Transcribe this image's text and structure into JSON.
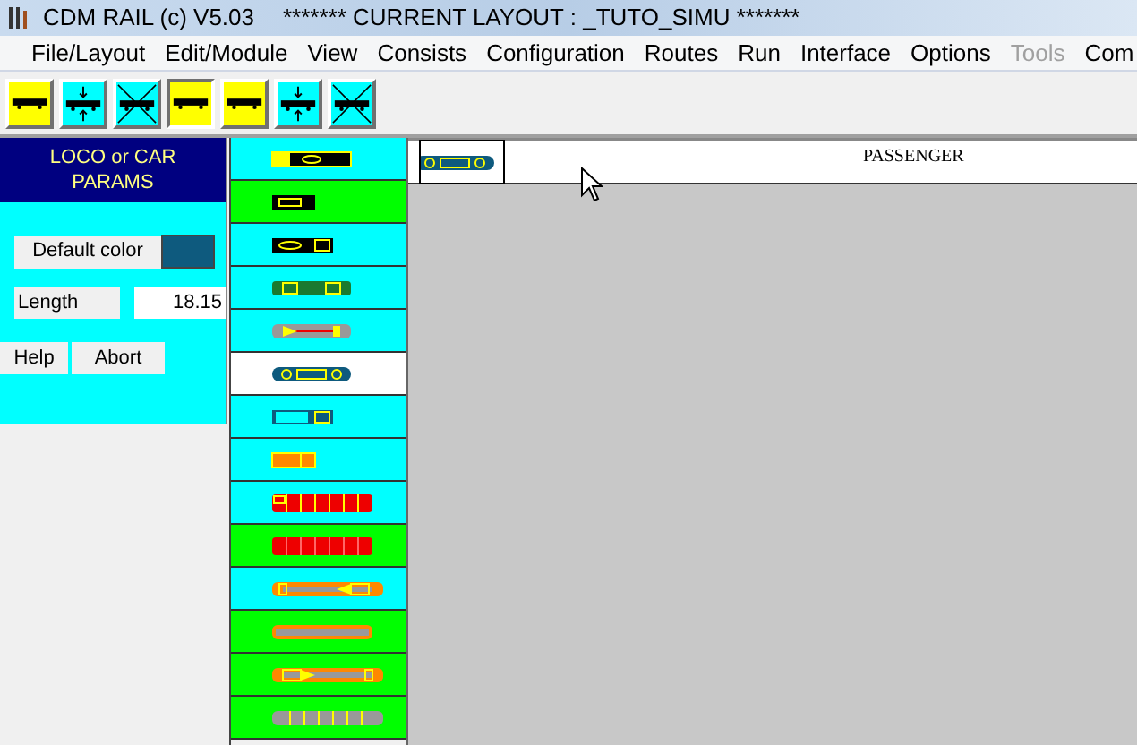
{
  "window": {
    "title": "CDM RAIL (c) V5.03",
    "layout_title": "******* CURRENT LAYOUT : _TUTO_SIMU *******"
  },
  "menu": [
    {
      "label": "File/Layout",
      "disabled": false
    },
    {
      "label": "Edit/Module",
      "disabled": false
    },
    {
      "label": "View",
      "disabled": false
    },
    {
      "label": "Consists",
      "disabled": false
    },
    {
      "label": "Configuration",
      "disabled": false
    },
    {
      "label": "Routes",
      "disabled": false
    },
    {
      "label": "Run",
      "disabled": false
    },
    {
      "label": "Interface",
      "disabled": false
    },
    {
      "label": "Options",
      "disabled": false
    },
    {
      "label": "Tools",
      "disabled": true
    },
    {
      "label": "Com",
      "disabled": false
    }
  ],
  "toolbar": [
    {
      "kind": "plain",
      "color": "#ffff00",
      "selected": false
    },
    {
      "kind": "arrows",
      "color": "#00ffff",
      "selected": false
    },
    {
      "kind": "crossed",
      "color": "#00ffff",
      "selected": false
    },
    {
      "kind": "plain",
      "color": "#ffff00",
      "selected": true
    },
    {
      "kind": "plain",
      "color": "#ffff00",
      "selected": false
    },
    {
      "kind": "arrows",
      "color": "#00ffff",
      "selected": false
    },
    {
      "kind": "crossed",
      "color": "#00ffff",
      "selected": false
    }
  ],
  "params": {
    "title": "LOCO or CAR PARAMS",
    "color_button": "Default color",
    "color": "#0e5a7e",
    "length_label": "Length",
    "length_value": "18.15",
    "buttons": [
      "Help",
      "Abort"
    ]
  },
  "cars": [
    {
      "kind": "diesel",
      "color": "#00ffff",
      "selected": false
    },
    {
      "kind": "boxcar",
      "color": "#00ff00",
      "selected": false
    },
    {
      "kind": "coach-dark",
      "color": "#00ffff",
      "selected": false
    },
    {
      "kind": "flat-green",
      "color": "#00ffff",
      "selected": false
    },
    {
      "kind": "tank-grey",
      "color": "#00ffff",
      "selected": false
    },
    {
      "kind": "coach-blue",
      "selected": true
    },
    {
      "kind": "coach-cyan",
      "color": "#00ffff",
      "selected": false
    },
    {
      "kind": "short-orange",
      "color": "#00ffff",
      "selected": false
    },
    {
      "kind": "freight-cab",
      "color": "#00ffff",
      "selected": false
    },
    {
      "kind": "freight-red",
      "color": "#00ff00",
      "selected": false
    },
    {
      "kind": "long-orange",
      "color": "#00ffff",
      "selected": false
    },
    {
      "kind": "long-plain",
      "color": "#00ff00",
      "selected": false
    },
    {
      "kind": "long-orange-rev",
      "color": "#00ff00",
      "selected": false
    },
    {
      "kind": "long-grey",
      "color": "#00ff00",
      "selected": false
    }
  ],
  "preview": {
    "kind": "coach-blue",
    "label": "PASSENGER"
  }
}
